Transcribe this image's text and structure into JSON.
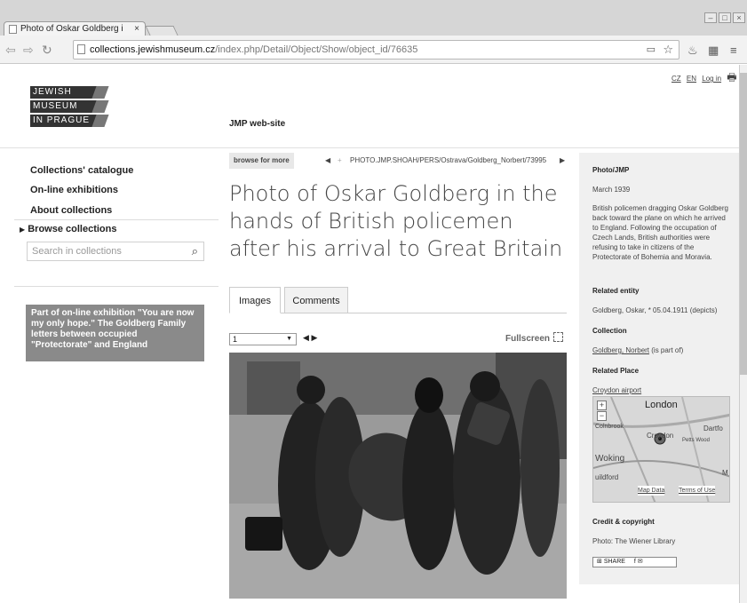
{
  "browser": {
    "tab_title": "Photo of Oskar Goldberg i",
    "tab_close": "×",
    "url_host": "collections.jewishmuseum.cz",
    "url_path": "/index.php/Detail/Object/Show/object_id/76635"
  },
  "site": {
    "logo_lines": [
      "JEWISH",
      "MUSEUM",
      "IN PRAGUE"
    ],
    "top_nav": [
      "CZ",
      "EN",
      "Log in"
    ],
    "jmp_link": "JMP web-site"
  },
  "menu": {
    "items": [
      "Collections' catalogue",
      "On-line exhibitions",
      "About collections"
    ],
    "browse": "Browse collections",
    "search_placeholder": "Search in collections",
    "promo": "Part of on-line exhibition \"You are now my only hope.\" The Goldberg Family letters between occupied \"Protectorate\" and England"
  },
  "detail": {
    "browse_more": "browse for more",
    "identifier": "PHOTO.JMP.SHOAH/PERS/Ostrava/Goldberg_Norbert/73995",
    "title": "Photo of Oskar Goldberg in the hands of British policemen after his arrival to Great Britain",
    "tabs": [
      "Images",
      "Comments"
    ],
    "page_select": "1",
    "fullscreen": "Fullscreen"
  },
  "sidebar": {
    "source": "Photo/JMP",
    "date": "March 1939",
    "description": "British policemen dragging Oskar Goldberg back toward the plane on which he arrived to England. Following the occupation of Czech Lands, British authorities were refusing to take in citizens of the Protectorate of Bohemia and Moravia.",
    "related_entity_label": "Related entity",
    "related_entity": "Goldberg, Oskar, * 05.04.1911 (depicts)",
    "collection_label": "Collection",
    "collection_link": "Goldberg, Norbert",
    "collection_suffix": " (is part of)",
    "related_place_label": "Related Place",
    "related_place": "Croydon airport",
    "map_labels": [
      "London",
      "Colnbrook",
      "Croydon",
      "Dartfo",
      "Petts Wood",
      "Woking",
      "uildford",
      "M",
      "Map Data",
      "Terms of Use"
    ],
    "credit_label": "Credit & copyright",
    "credit": "Photo: The Wiener Library",
    "share": "SHARE"
  }
}
